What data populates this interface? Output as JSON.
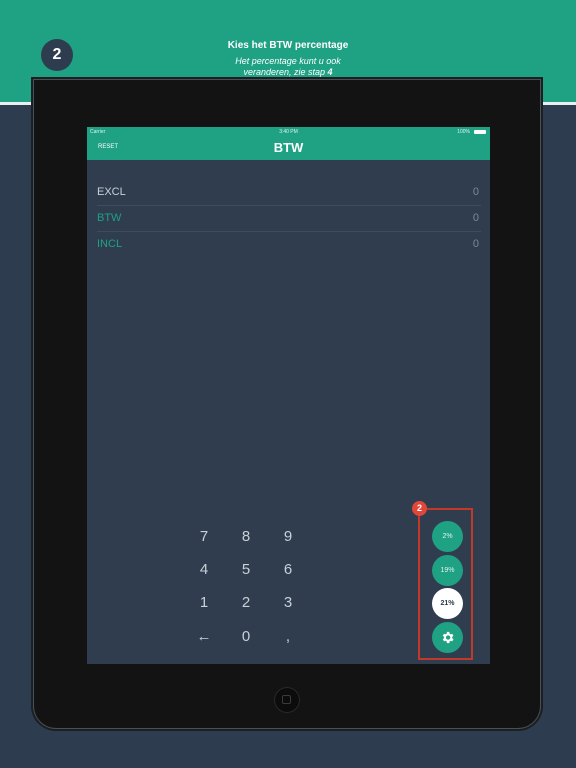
{
  "banner": {
    "step_number": "2",
    "title": "Kies het BTW percentage",
    "subtitle_line1": "Het percentage kunt u ook",
    "subtitle_line2_prefix": "veranderen, zie stap ",
    "subtitle_step": "4"
  },
  "status_bar": {
    "carrier": "Carrier",
    "time": "3:40 PM",
    "battery": "100%"
  },
  "navbar": {
    "reset_label": "RESET",
    "title": "BTW"
  },
  "rows": [
    {
      "label": "EXCL",
      "value": "0"
    },
    {
      "label": "BTW",
      "value": "0"
    },
    {
      "label": "INCL",
      "value": "0"
    }
  ],
  "keypad": {
    "keys": [
      "7",
      "8",
      "9",
      "4",
      "5",
      "6",
      "1",
      "2",
      "3",
      "←",
      "0",
      ","
    ]
  },
  "callout_badge": "2",
  "percent_buttons": [
    {
      "label": "2%",
      "selected": false
    },
    {
      "label": "19%",
      "selected": false
    },
    {
      "label": "21%",
      "selected": true
    }
  ],
  "settings_icon": "gear-icon",
  "colors": {
    "accent": "#1fa184",
    "background": "#2d3c4f",
    "highlight": "#c0392b"
  }
}
